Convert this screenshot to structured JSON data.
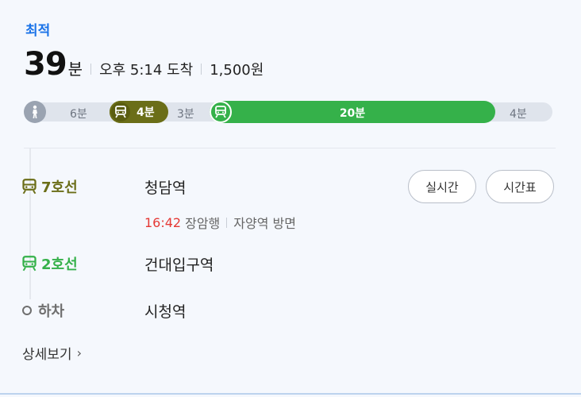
{
  "route": {
    "badge": "최적",
    "duration_value": "39",
    "duration_unit": "분",
    "arrival": "오후 5:14 도착",
    "fare": "1,500원"
  },
  "segments": {
    "walk_start": "6분",
    "line7": "4분",
    "transfer": "3분",
    "line2": "20분",
    "walk_end": "4분"
  },
  "steps": {
    "step1": {
      "line": "7호선",
      "station": "청담역",
      "departure_time": "16:42",
      "destination": "장암행",
      "direction": "자양역 방면"
    },
    "step2": {
      "line": "2호선",
      "station": "건대입구역"
    },
    "step3": {
      "line": "하차",
      "station": "시청역"
    }
  },
  "buttons": {
    "realtime": "실시간",
    "timetable": "시간표"
  },
  "more": {
    "label": "상세보기",
    "chevron": "›"
  },
  "colors": {
    "line7": "#6b6e18",
    "line2": "#35b14a",
    "badge": "#1a73e8",
    "departure_time": "#e53935",
    "walk": "#9aa3b1"
  },
  "icons": [
    "walk-icon",
    "subway-icon",
    "chevron-right-icon"
  ]
}
